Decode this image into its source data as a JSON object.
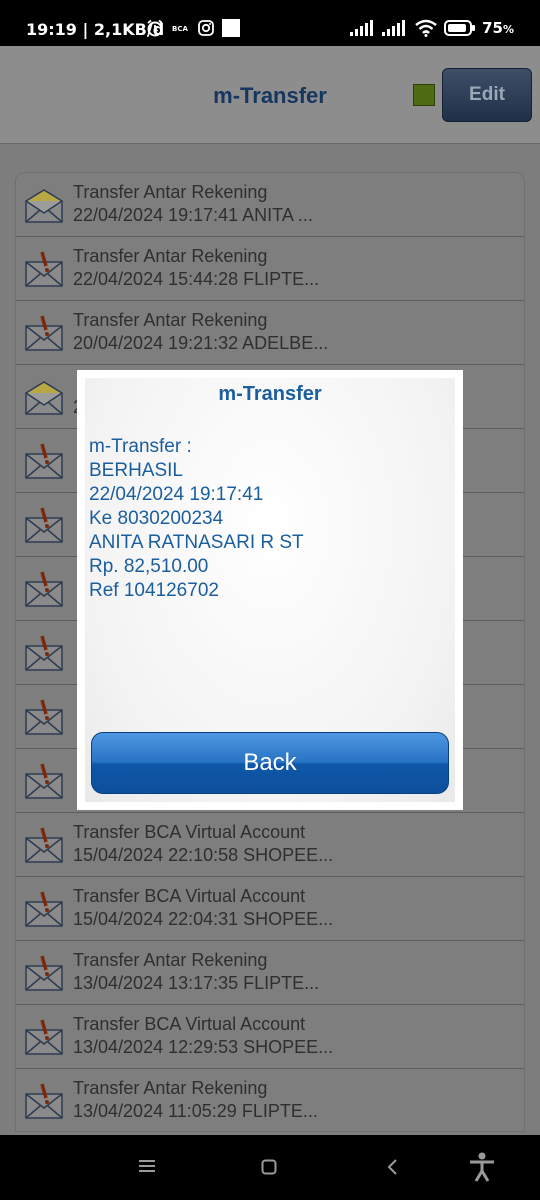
{
  "status_bar": {
    "time_info": "19:19 | 2,1KB/d",
    "battery": "75"
  },
  "header": {
    "title": "m-Transfer",
    "edit_label": "Edit",
    "indicator_color": "#4c6b12"
  },
  "list": {
    "items": [
      {
        "icon": "envelope-read-icon",
        "title": "Transfer Antar Rekening",
        "detail": "22/04/2024 19:17:41 ANITA ..."
      },
      {
        "icon": "envelope-unread-icon",
        "title": "Transfer Antar Rekening",
        "detail": "22/04/2024 15:44:28 FLIPTE..."
      },
      {
        "icon": "envelope-unread-icon",
        "title": "Transfer Antar Rekening",
        "detail": "20/04/2024 19:21:32 ADELBE..."
      },
      {
        "icon": "envelope-read-icon",
        "title": "",
        "detail": "2"
      },
      {
        "icon": "envelope-unread-icon",
        "title": "",
        "detail": ""
      },
      {
        "icon": "envelope-unread-icon",
        "title": "",
        "detail": ""
      },
      {
        "icon": "envelope-unread-icon",
        "title": "",
        "detail": ""
      },
      {
        "icon": "envelope-unread-icon",
        "title": "",
        "detail": ""
      },
      {
        "icon": "envelope-unread-icon",
        "title": "",
        "detail": ""
      },
      {
        "icon": "envelope-unread-icon",
        "title": "",
        "detail": ""
      },
      {
        "icon": "envelope-unread-icon",
        "title": "Transfer BCA Virtual Account",
        "detail": "15/04/2024 22:10:58 SHOPEE..."
      },
      {
        "icon": "envelope-unread-icon",
        "title": "Transfer BCA Virtual Account",
        "detail": "15/04/2024 22:04:31 SHOPEE..."
      },
      {
        "icon": "envelope-unread-icon",
        "title": "Transfer Antar Rekening",
        "detail": "13/04/2024 13:17:35 FLIPTE..."
      },
      {
        "icon": "envelope-unread-icon",
        "title": "Transfer BCA Virtual Account",
        "detail": "13/04/2024 12:29:53 SHOPEE..."
      },
      {
        "icon": "envelope-unread-icon",
        "title": "Transfer Antar Rekening",
        "detail": "13/04/2024 11:05:29 FLIPTE..."
      }
    ]
  },
  "dialog": {
    "title": "m-Transfer",
    "lines": [
      "m-Transfer :",
      "BERHASIL",
      "22/04/2024 19:17:41",
      "Ke 8030200234",
      "ANITA RATNASARI R ST",
      "Rp. 82,510.00",
      "Ref 104126702"
    ],
    "back_label": "Back"
  },
  "colors": {
    "accent": "#1b5e9e",
    "button": "#2874c4"
  }
}
